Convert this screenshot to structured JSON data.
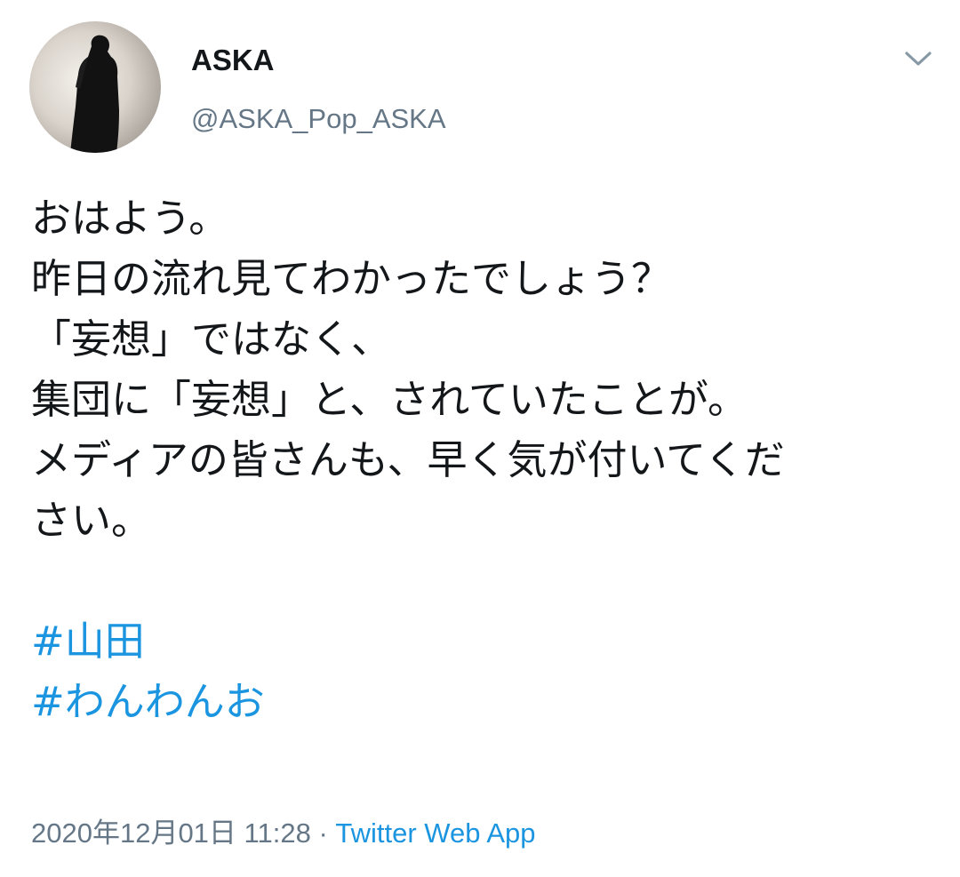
{
  "author": {
    "display_name": "ASKA",
    "handle": "@ASKA_Pop_ASKA"
  },
  "tweet": {
    "lines": [
      "おはよう。",
      "昨日の流れ見てわかったでしょう？",
      "「妄想」ではなく、",
      "集団に「妄想」と、されていたことが。",
      "メディアの皆さんも、早く気が付いてくだ",
      "さい。"
    ],
    "hashtags": [
      "#山田",
      "#わんわんお"
    ],
    "timestamp": "2020年12月01日 11:28",
    "separator": " · ",
    "source": "Twitter Web App"
  },
  "icons": {
    "menu": "chevron-down-icon",
    "avatar": "avatar-silhouette"
  },
  "colors": {
    "link": "#1b95e0",
    "secondary_text": "#657786",
    "primary_text": "#14171a"
  }
}
